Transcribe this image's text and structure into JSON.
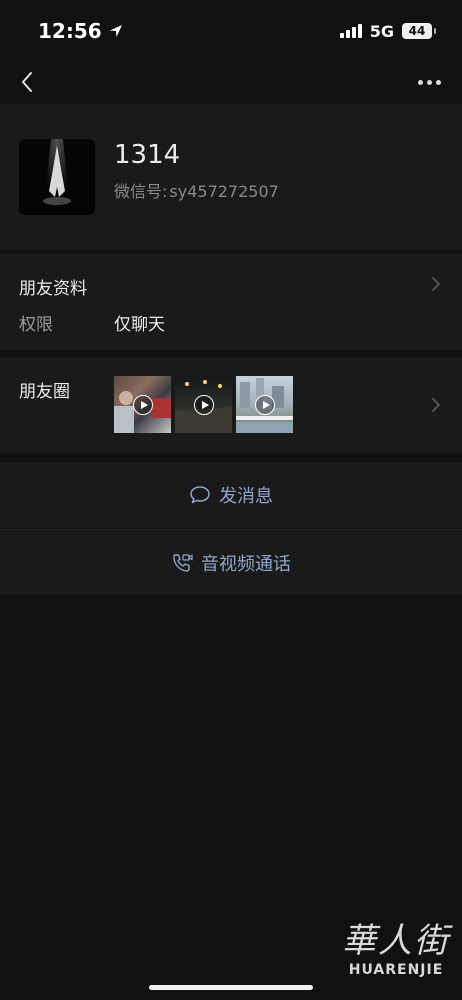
{
  "status_bar": {
    "time": "12:56",
    "network": "5G",
    "battery": "44"
  },
  "profile": {
    "nickname": "1314",
    "wechat_id_label": "微信号:",
    "wechat_id": "sy457272507"
  },
  "friend_info": {
    "title": "朋友资料",
    "permission_label": "权限",
    "permission_value": "仅聊天"
  },
  "moments": {
    "title": "朋友圈",
    "thumbnails": [
      "video",
      "video",
      "video"
    ]
  },
  "actions": {
    "message": "发消息",
    "call": "音视频通话"
  },
  "watermark": {
    "cn": "華人街",
    "en": "HUARENJIE"
  },
  "colors": {
    "background": "#111111",
    "card": "#1a1a1a",
    "link": "#8fa6c9"
  }
}
